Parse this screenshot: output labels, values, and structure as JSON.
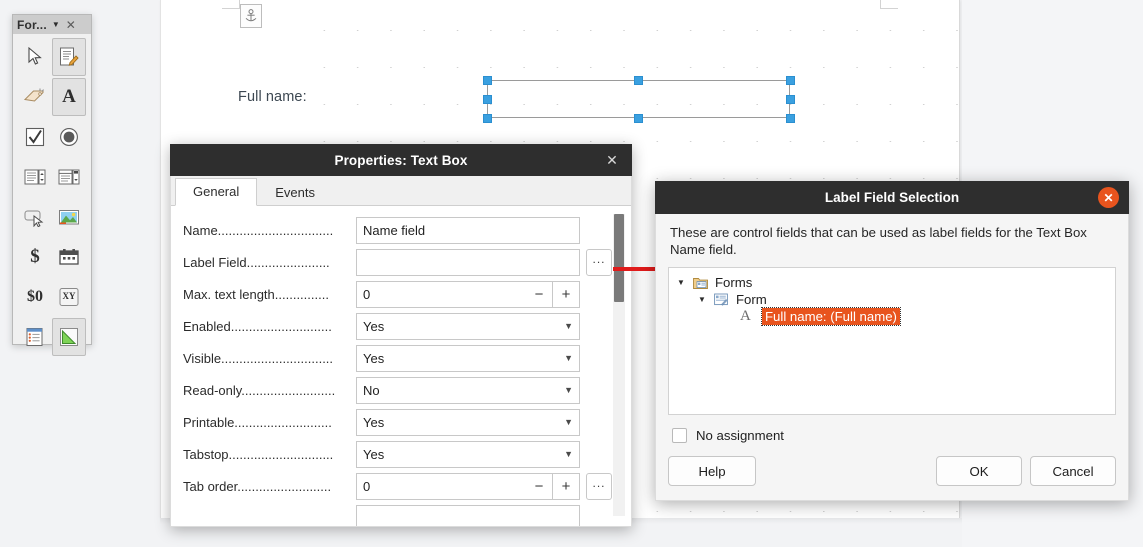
{
  "document": {
    "form_label": "Full name:",
    "anchor_icon": "anchor-icon"
  },
  "toolbar": {
    "title": "For...",
    "dropdown_glyph": "▼",
    "close_glyph": "✕",
    "items": [
      {
        "name": "select-tool",
        "icon": "cursor-arrow-icon",
        "active": false
      },
      {
        "name": "design-mode-tool",
        "icon": "form-design-icon",
        "active": true
      },
      {
        "name": "toggle-wizards-tool",
        "icon": "wand-tag-icon",
        "active": false
      },
      {
        "name": "label-field-tool",
        "icon": "letter-a-icon",
        "active": true
      },
      {
        "name": "check-box-tool",
        "icon": "checkbox-icon",
        "active": false
      },
      {
        "name": "option-button-tool",
        "icon": "radio-button-icon",
        "active": false
      },
      {
        "name": "list-box-tool",
        "icon": "list-box-icon",
        "active": false
      },
      {
        "name": "combo-box-tool",
        "icon": "combo-box-icon",
        "active": false
      },
      {
        "name": "push-button-tool",
        "icon": "push-button-icon",
        "active": false
      },
      {
        "name": "image-button-tool",
        "icon": "image-button-icon",
        "active": false
      },
      {
        "name": "currency-field-tool",
        "icon": "dollar-icon",
        "active": false
      },
      {
        "name": "date-field-tool",
        "icon": "calendar-icon",
        "active": false
      },
      {
        "name": "formatted-field-tool",
        "icon": "dollar-zero-icon",
        "active": false
      },
      {
        "name": "pattern-field-tool",
        "icon": "xy-field-icon",
        "active": false
      },
      {
        "name": "table-control-tool",
        "icon": "table-control-icon",
        "active": false
      },
      {
        "name": "more-controls-tool",
        "icon": "triangle-ruler-icon",
        "active": true
      }
    ]
  },
  "properties_dialog": {
    "title": "Properties: Text Box",
    "close_glyph": "✕",
    "tabs": [
      {
        "label": "General",
        "active": true
      },
      {
        "label": "Events",
        "active": false
      }
    ],
    "rows": [
      {
        "label": "Name................................",
        "type": "text",
        "value": "Name field",
        "placeholder": "",
        "extra": ""
      },
      {
        "label": "Label Field.......................",
        "type": "text",
        "value": "",
        "placeholder": "",
        "extra": "..."
      },
      {
        "label": "Max. text length...............",
        "type": "spin",
        "value": "0",
        "placeholder": "",
        "extra": ""
      },
      {
        "label": "Enabled............................",
        "type": "combo",
        "value": "Yes",
        "placeholder": "",
        "extra": ""
      },
      {
        "label": "Visible...............................",
        "type": "combo",
        "value": "Yes",
        "placeholder": "",
        "extra": ""
      },
      {
        "label": "Read-only..........................",
        "type": "combo",
        "value": "No",
        "placeholder": "",
        "extra": ""
      },
      {
        "label": "Printable...........................",
        "type": "combo",
        "value": "Yes",
        "placeholder": "",
        "extra": ""
      },
      {
        "label": "Tabstop.............................",
        "type": "combo",
        "value": "Yes",
        "placeholder": "",
        "extra": ""
      },
      {
        "label": "Tab order..........................",
        "type": "spin",
        "value": "0",
        "placeholder": "",
        "extra": "..."
      }
    ],
    "spin_minus": "−",
    "spin_plus": "+",
    "combo_arrow": "▼"
  },
  "label_field_dialog": {
    "title": "Label Field Selection",
    "close_glyph": "✕",
    "description": "These are control fields that can be used as label fields for the Text Box Name field.",
    "tree": [
      {
        "label": "Forms",
        "level": 1,
        "twisty": "▼",
        "icon": "forms-folder-icon",
        "selected": false
      },
      {
        "label": "Form",
        "level": 2,
        "twisty": "▼",
        "icon": "form-icon",
        "selected": false
      },
      {
        "label": "Full name: (Full name)",
        "level": 3,
        "twisty": "",
        "icon": "letter-a-icon",
        "selected": true
      }
    ],
    "no_assignment_label": "No assignment",
    "no_assignment_checked": false,
    "buttons": {
      "help": "Help",
      "ok": "OK",
      "cancel": "Cancel"
    }
  },
  "annotation": {
    "arrow_color": "#e01b1b"
  },
  "colors": {
    "titlebar": "#2e2e2e",
    "accent_orange": "#e8541e",
    "handle_blue": "#3aa0e0",
    "workspace": "#f2f3f5"
  }
}
